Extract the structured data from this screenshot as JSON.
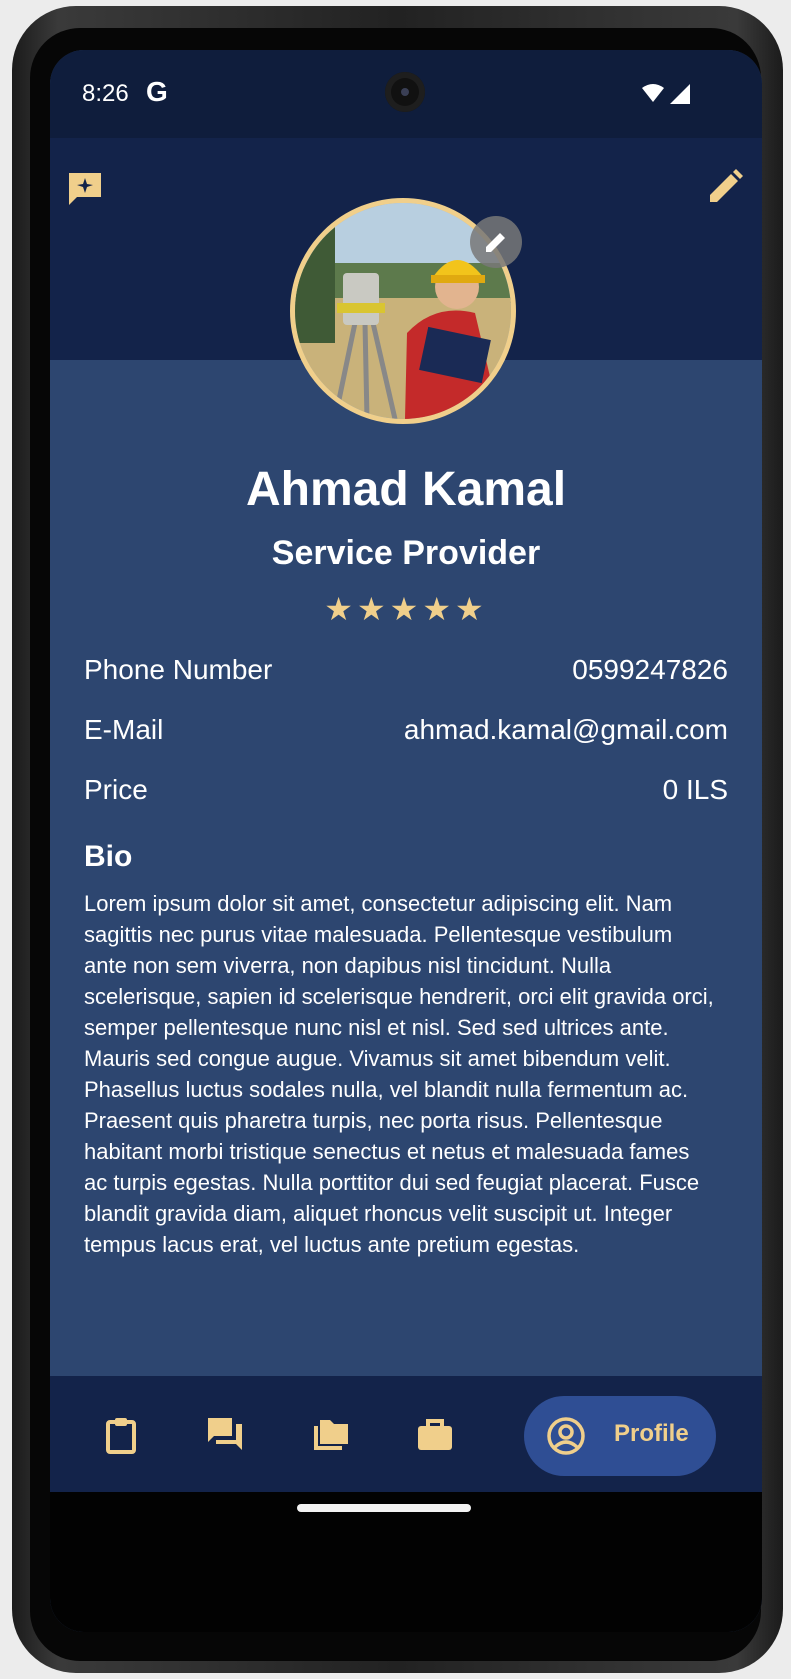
{
  "status_bar": {
    "time": "8:26",
    "g_icon": "G",
    "icons": [
      "wifi-icon",
      "cell-signal-icon"
    ]
  },
  "header": {
    "left_icon": "ai-chat-icon",
    "right_icon": "pencil-icon",
    "avatar_edit_icon": "pencil-icon"
  },
  "profile": {
    "name": "Ahmad Kamal",
    "role": "Service Provider",
    "rating": "★★★★★",
    "rating_value": 5,
    "rating_max": 5
  },
  "info": {
    "phone_label": "Phone Number",
    "phone_value": "0599247826",
    "email_label": "E-Mail",
    "email_value": "ahmad.kamal@gmail.com",
    "price_label": "Price",
    "price_value": "0 ILS"
  },
  "bio": {
    "title": "Bio",
    "text": "Lorem ipsum dolor sit amet, consectetur adipiscing elit. Nam sagittis nec purus vitae malesuada. Pellentesque vestibulum ante non sem viverra, non dapibus nisl tincidunt. Nulla scelerisque, sapien id scelerisque hendrerit, orci elit gravida orci, semper pellentesque nunc nisl et nisl. Sed sed ultrices ante. Mauris sed congue augue. Vivamus sit amet bibendum velit. Phasellus luctus sodales nulla, vel blandit nulla fermentum ac. Praesent quis pharetra turpis, nec porta risus. Pellentesque habitant morbi tristique senectus et netus et malesuada fames ac turpis egestas. Nulla porttitor dui sed feugiat placerat. Fusce blandit gravida diam, aliquet rhoncus velit suscipit ut. Integer tempus lacus erat, vel luctus ante pretium egestas."
  },
  "bottom_nav": {
    "items": [
      {
        "icon": "clipboard-icon"
      },
      {
        "icon": "chat-icon"
      },
      {
        "icon": "folders-icon"
      },
      {
        "icon": "briefcase-icon"
      }
    ],
    "active_label": "Profile",
    "active_icon": "account-circle-icon"
  },
  "colors": {
    "background": "#2d4670",
    "header_band": "#13234a",
    "accent_gold": "#f0cf8b",
    "nav_active": "#2f4e94",
    "text": "#ffffff"
  }
}
